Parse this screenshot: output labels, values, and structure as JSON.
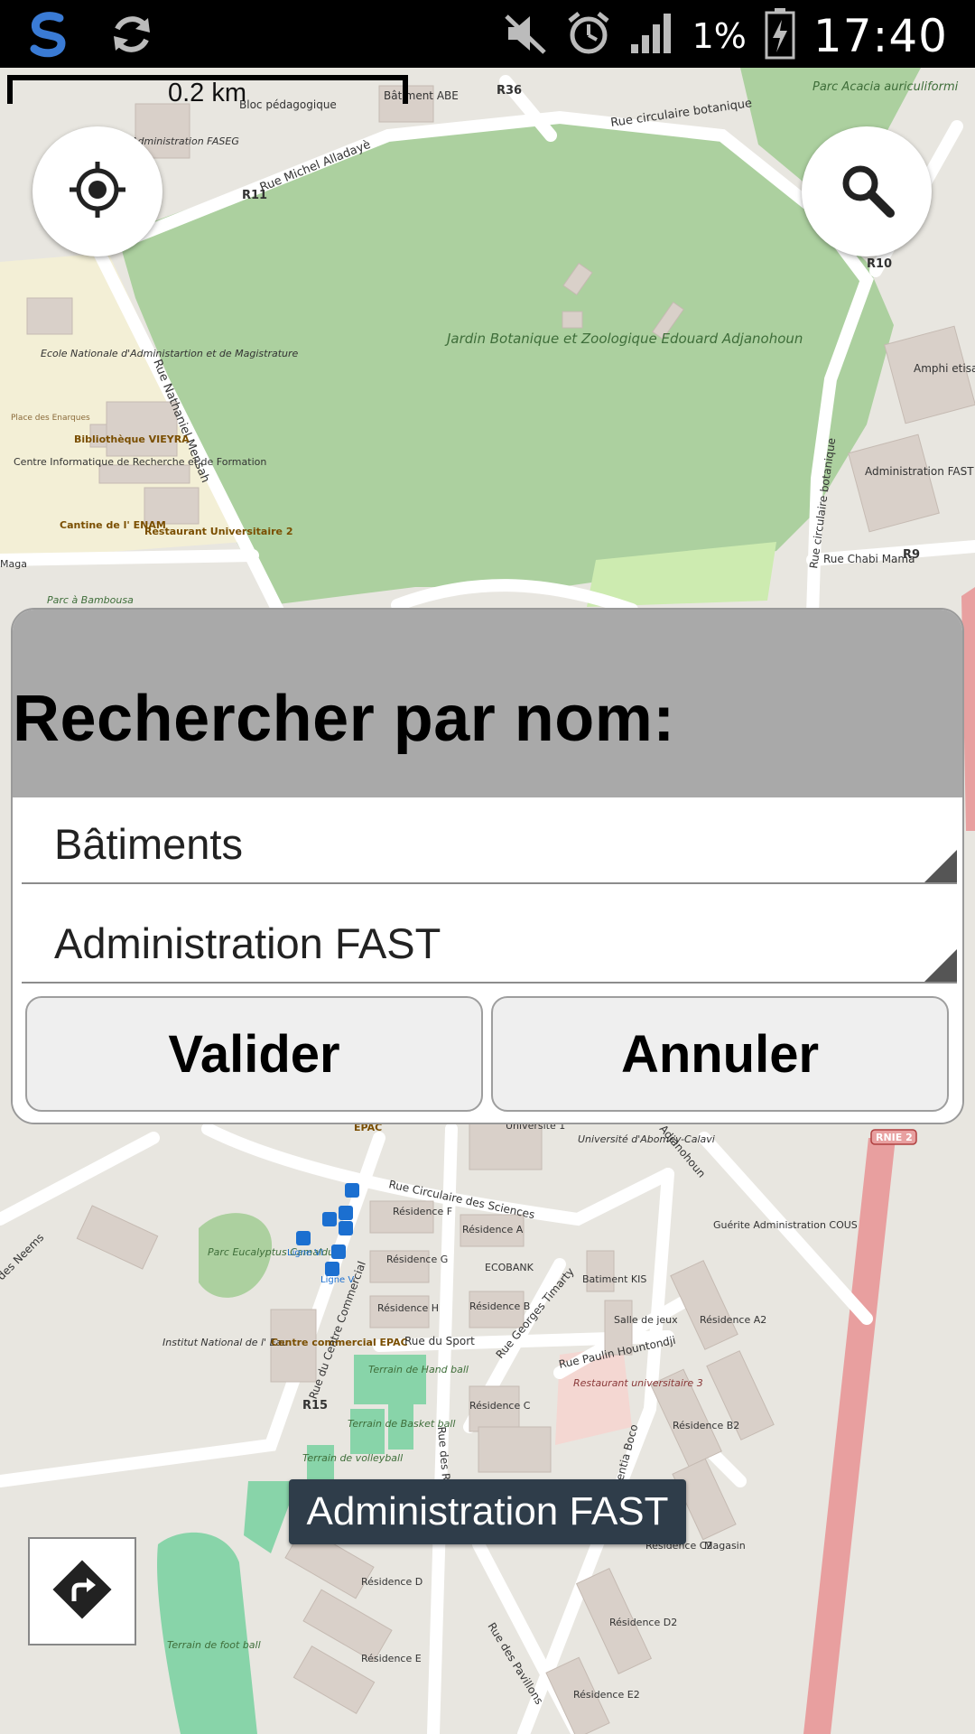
{
  "status_bar": {
    "clock": "17:40",
    "battery_percent": "1%",
    "icons": [
      "app-s-logo-icon",
      "sync-icon",
      "mute-icon",
      "alarm-icon",
      "signal-icon",
      "battery-icon"
    ]
  },
  "map": {
    "scale_label": "0.2 km",
    "labels": {
      "parc_acacia": "Parc Acacia auriculiformi",
      "rue_circulaire_botanique": "Rue circulaire botanique",
      "rue_michel": "Rue Michel Alladayè",
      "r11": "R11",
      "r36": "R36",
      "r10": "R10",
      "r9": "R9",
      "r15": "R15",
      "rnie2": "RNIE 2",
      "batiment_abe": "Bâtiment ABE",
      "bloc_pedagogique": "Bloc pédagogique",
      "administration_faseg": "Administration FASEG",
      "jardin": "Jardin Botanique et Zoologique Edouard Adjanohoun",
      "rue_nathaniel": "Rue Nathaniel Mensah",
      "enam": "Ecole Nationale d'Administartion et de Magistrature",
      "place_enarques": "Place des Enarques",
      "bibliotheque": "Bibliothèque VIEYRA",
      "centre_info": "Centre Informatique de Recherche et de Formation",
      "cantine": "Cantine de l' ENAM",
      "restaurant_2": "Restaurant Universitaire 2",
      "maga": "Maga",
      "parc_bambousa": "Parc à Bambousa",
      "amphi": "Amphi etisalat",
      "administration_fast": "Administration FAST",
      "rue_chabi": "Rue Chabi Mama",
      "rue_circulaire_botanique_v": "Rue circulaire botanique",
      "rue_circulaire_sciences": "Rue Circulaire des Sciences",
      "residence_f": "Résidence F",
      "residence_a": "Résidence A",
      "ecobank": "ECOBANK",
      "residence_g": "Résidence G",
      "residence_h": "Résidence H",
      "residence_b": "Résidence B",
      "batiment_kis": "Batiment KIS",
      "salle_jeux": "Salle de jeux",
      "universite": "Université d'Abomey-Calavi",
      "guerite": "Guérite Administration COUS",
      "residence_a2": "Résidence A2",
      "parc_eucalyptus": "Parc Eucalyptus Camaldus",
      "ligne_vi": "Ligne VI",
      "ligne_v": "Ligne V",
      "institut_eau": "Institut National de l' Eau",
      "centre_commercial": "Centre commercial EPAC",
      "rue_centre_commercial": "Rue du Centre Commercial",
      "rue_sport": "Rue du Sport",
      "rue_georges": "Rue Georges Timarty",
      "rue_paulin": "Rue Paulin Hountondji",
      "restaurant_3": "Restaurant universitaire 3",
      "terrain_hand": "Terrain de Hand ball",
      "terrain_basket": "Terrain de Basket ball",
      "terrain_volley": "Terrain de volleyball",
      "residence_c": "Résidence C",
      "residence_b2": "Résidence B2",
      "residence_c2": "Résidence C2",
      "magasin": "Magasin",
      "residence_d": "Résidence D",
      "residence_d2": "Résidence D2",
      "residence_e": "Résidence E",
      "residence_e2": "Résidence E2",
      "terrain_foot": "Terrain de foot ball",
      "rue_pavillons": "Rue des Pavillons",
      "rue_neems": "des Neems",
      "epac": "EPAC",
      "universite_1": "Universite 1",
      "adjanohoun": "Adjanohoun",
      "rue_des_r": "Rue des R",
      "boco": "entia Boco"
    }
  },
  "dialog": {
    "title": "Rechercher par nom:",
    "category_spinner": "Bâtiments",
    "name_spinner": "Administration FAST",
    "validate_label": "Valider",
    "cancel_label": "Annuler"
  },
  "toast": {
    "text": "Administration FAST"
  },
  "buttons": {
    "locate_icon": "crosshair-icon",
    "search_icon": "search-icon",
    "route_icon": "route-arrow-icon"
  }
}
